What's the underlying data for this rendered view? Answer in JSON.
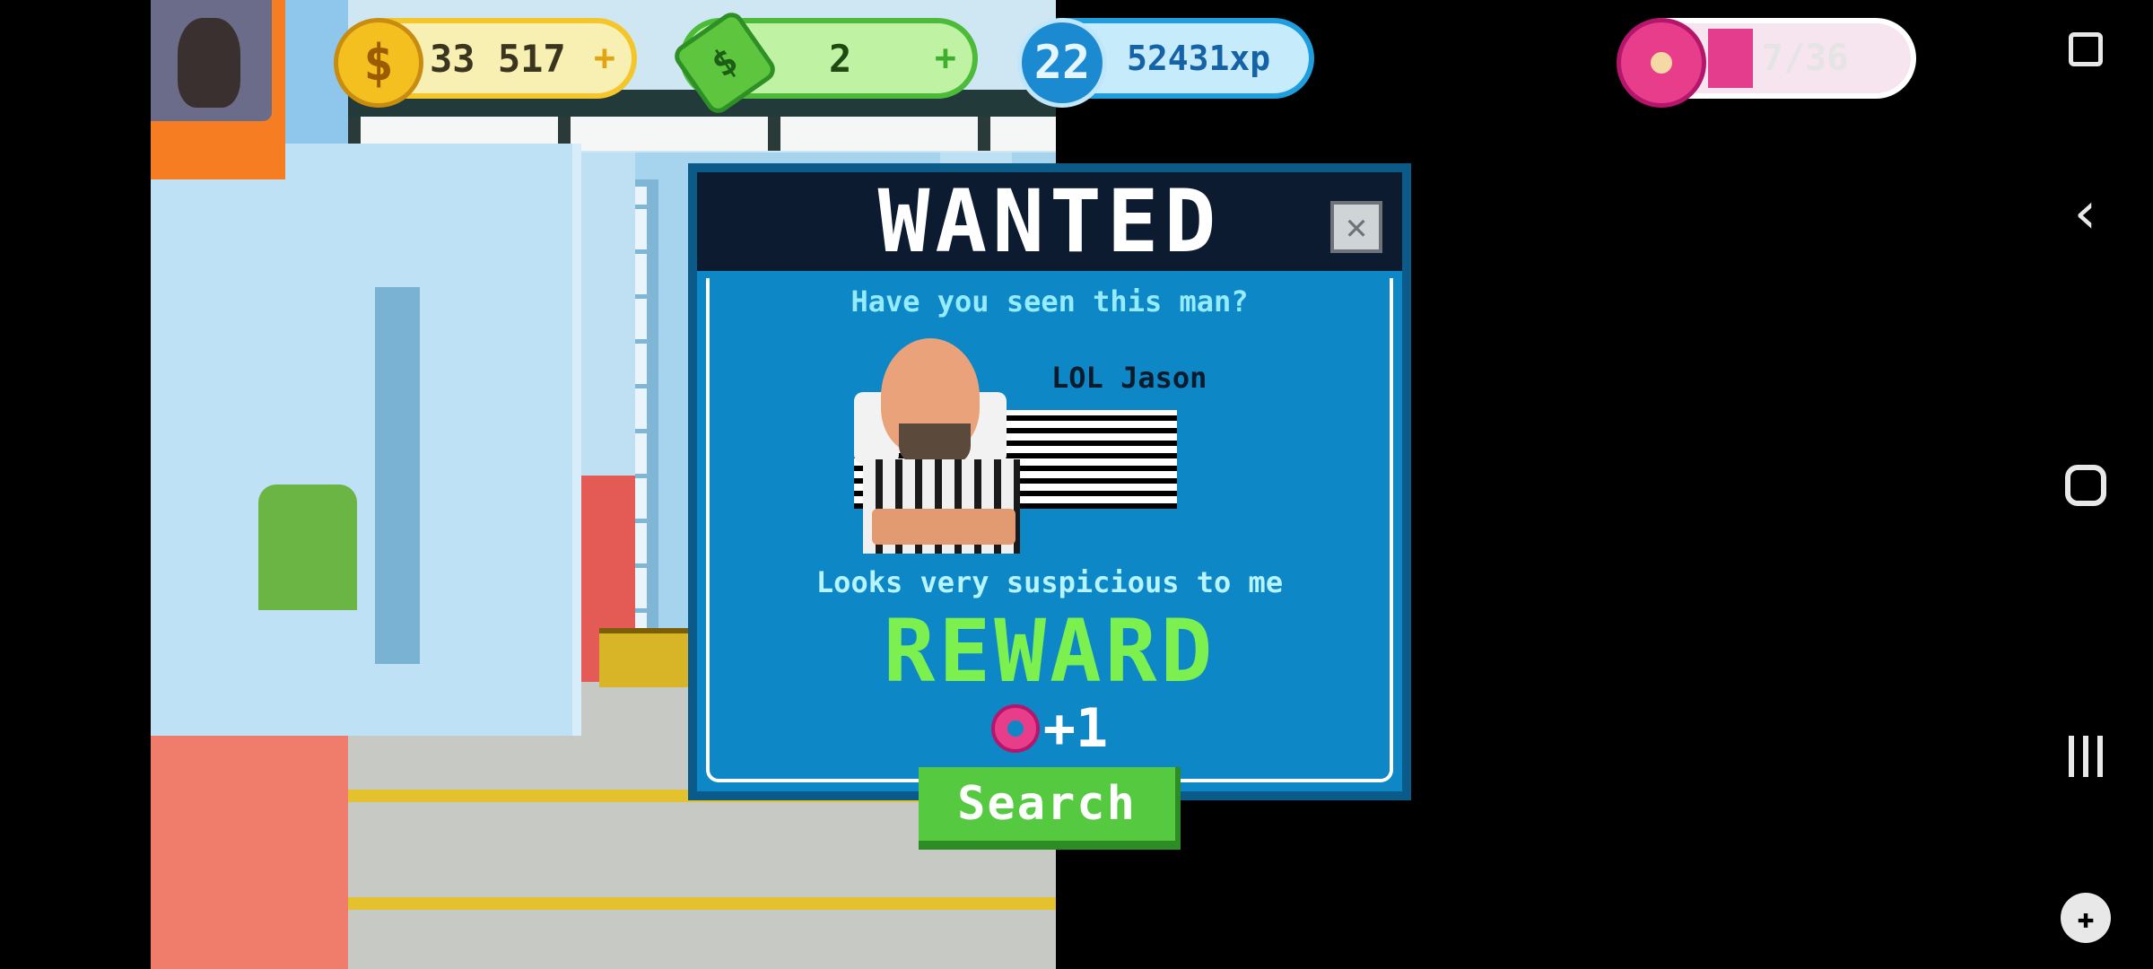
{
  "hud": {
    "coins": "33 517",
    "coins_plus": "+",
    "cash": "2",
    "cash_plus": "+",
    "level": "22",
    "xp": "52431xp",
    "donuts": "7/36"
  },
  "modal": {
    "title": "WANTED",
    "close": "✕",
    "subtitle": "Have you seen this man?",
    "suspect_name": "LOL Jason",
    "description": "Looks very suspicious to me",
    "reward_label": "REWARD",
    "reward_amount": "+1",
    "search_label": "Search"
  },
  "system_nav": {
    "back": "‹",
    "recents": "|||"
  },
  "colors": {
    "modal_bg": "#0d87c6",
    "header_bg": "#0d1b31",
    "reward_green": "#7cf04e",
    "search_btn": "#55c93f",
    "donut_pink": "#e83d8b"
  }
}
